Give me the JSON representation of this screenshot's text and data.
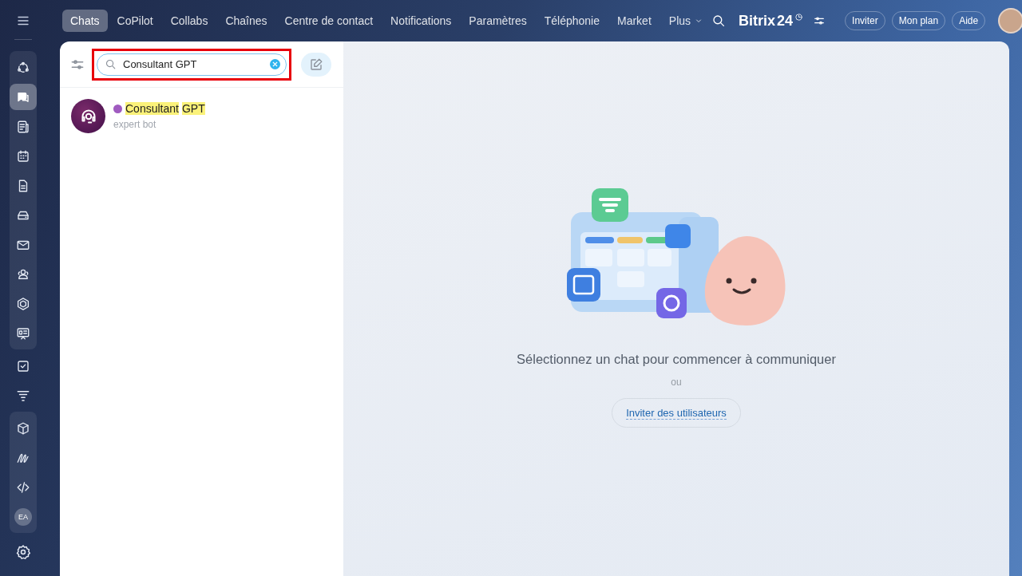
{
  "top_nav": {
    "tabs": [
      {
        "label": "Chats",
        "selected": true
      },
      {
        "label": "CoPilot",
        "selected": false
      },
      {
        "label": "Collabs",
        "selected": false
      },
      {
        "label": "Chaînes",
        "selected": false
      },
      {
        "label": "Centre de contact",
        "selected": false
      },
      {
        "label": "Notifications",
        "selected": false
      },
      {
        "label": "Paramètres",
        "selected": false
      },
      {
        "label": "Téléphonie",
        "selected": false
      },
      {
        "label": "Market",
        "selected": false
      },
      {
        "label": "Plus",
        "selected": false,
        "kind": "dropdown"
      }
    ],
    "logo": {
      "name": "Bitrix",
      "number": "24"
    },
    "buttons": [
      "Inviter",
      "Mon plan",
      "Aide"
    ]
  },
  "sidebar": {
    "groups": [
      {
        "framed": true,
        "items": [
          {
            "kind": "activity",
            "selected": false
          },
          {
            "kind": "chat",
            "selected": true
          },
          {
            "kind": "feed",
            "selected": false
          },
          {
            "kind": "calendar",
            "selected": false
          },
          {
            "kind": "document",
            "selected": false
          },
          {
            "kind": "drive",
            "selected": false
          },
          {
            "kind": "mail",
            "selected": false
          },
          {
            "kind": "contacts",
            "selected": false
          },
          {
            "kind": "hexagon",
            "selected": false
          },
          {
            "kind": "board",
            "selected": false
          }
        ]
      },
      {
        "framed": false,
        "items": [
          {
            "kind": "tasks",
            "selected": false
          },
          {
            "kind": "funnel",
            "selected": false
          }
        ]
      },
      {
        "framed": true,
        "items": [
          {
            "kind": "box",
            "selected": false
          },
          {
            "kind": "sign",
            "selected": false
          },
          {
            "kind": "code",
            "selected": false
          },
          {
            "kind": "initials",
            "label": "EA",
            "selected": false
          }
        ]
      }
    ]
  },
  "chat_list": {
    "search": {
      "value": "Consultant GPT",
      "highlighted": true
    },
    "results": [
      {
        "name_parts": [
          {
            "text": "Consultant",
            "highlighted": true
          },
          {
            "text": "GPT",
            "highlighted": true
          }
        ],
        "subtitle": "expert bot"
      }
    ]
  },
  "empty_state": {
    "message": "Sélectionnez un chat pour commencer à communiquer",
    "separator": "ou",
    "button": "Inviter des utilisateurs"
  }
}
